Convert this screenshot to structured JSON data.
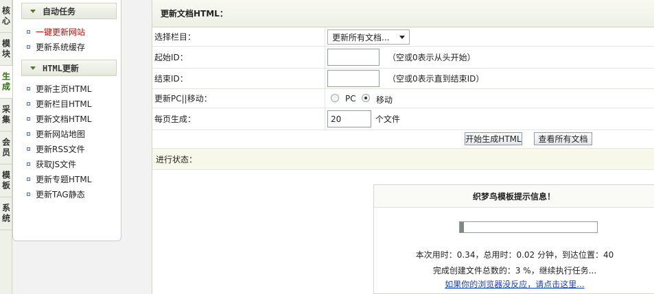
{
  "sidebar_tabs": [
    "核心",
    "模块",
    "生成",
    "采集",
    "会员",
    "模板",
    "系统"
  ],
  "menu": {
    "groups": [
      {
        "title": "自动任务",
        "items": [
          "一键更新网站",
          "更新系统缓存"
        ]
      },
      {
        "title": "HTML更新",
        "items": [
          "更新主页HTML",
          "更新栏目HTML",
          "更新文档HTML",
          "更新网站地图",
          "更新RSS文件",
          "获取JS文件",
          "更新专题HTML",
          "更新TAG静态"
        ]
      }
    ]
  },
  "main": {
    "title": "更新文档HTML：",
    "rows": {
      "column_label": "选择栏目：",
      "column_select": "更新所有文档...",
      "start_label": "起始ID：",
      "start_value": "",
      "start_hint": "（空或0表示从头开始）",
      "end_label": "结束ID：",
      "end_value": "",
      "end_hint": "（空或0表示直到结束ID）",
      "mode_label": "更新PC||移动：",
      "mode_pc": "PC",
      "mode_mobile": "移动",
      "per_page_label": "每页生成：",
      "per_page_value": "20",
      "per_page_unit": "个文件"
    },
    "buttons": {
      "start": "开始生成HTML",
      "view_all": "查看所有文档"
    },
    "status_label": "进行状态："
  },
  "notice": {
    "title": "织梦鸟模板提示信息！",
    "progress": 0.03,
    "line1": "本次用时：0.34，总用时：0.02 分钟，到达位置：40",
    "line2": "完成创建文件总数的：3 %，继续执行任务...",
    "link": "如果你的浏览器没反应，请点击这里..."
  },
  "colors": {
    "active_tab": "#2e6f12",
    "highlight_item": "#dd0000",
    "link": "#1a3fbf",
    "status_bg": "#f7f8ea"
  }
}
